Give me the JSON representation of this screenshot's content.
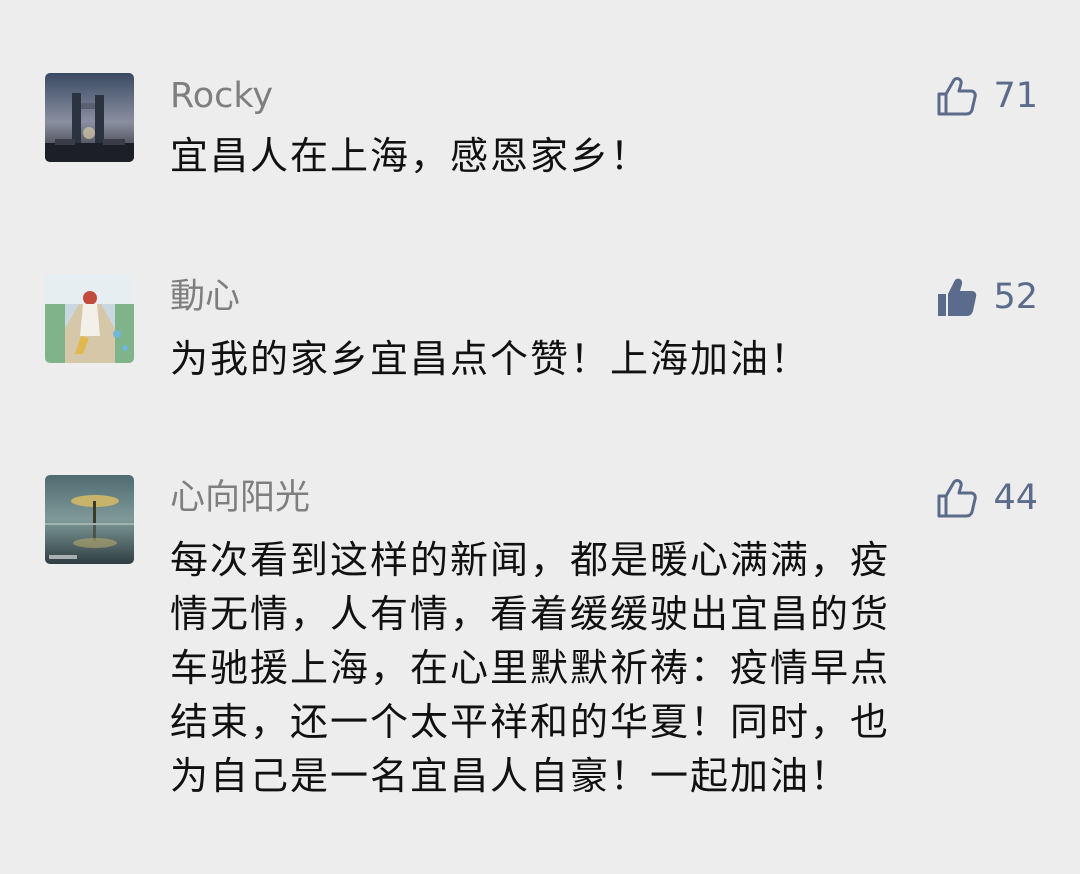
{
  "comments": [
    {
      "username": "Rocky",
      "like_count": "71",
      "liked": false,
      "text": "宜昌人在上海，感恩家乡！"
    },
    {
      "username": "動心",
      "like_count": "52",
      "liked": true,
      "text": "为我的家乡宜昌点个赞！上海加油！"
    },
    {
      "username": "心向阳光",
      "like_count": "44",
      "liked": false,
      "text_lines": [
        "每次看到这样的新闻，都是暖心满满，疫",
        "情无情，人有情，看着缓缓驶出宜昌的货",
        "车驰援上海，在心里默默祈祷：疫情早点",
        "结束，还一个太平祥和的华夏！同时，也",
        "为自己是一名宜昌人自豪！一起加油！"
      ]
    }
  ],
  "colors": {
    "background": "#ededed",
    "username": "#7f7f7f",
    "like_accent": "#5a6b8c",
    "text": "#111111"
  }
}
